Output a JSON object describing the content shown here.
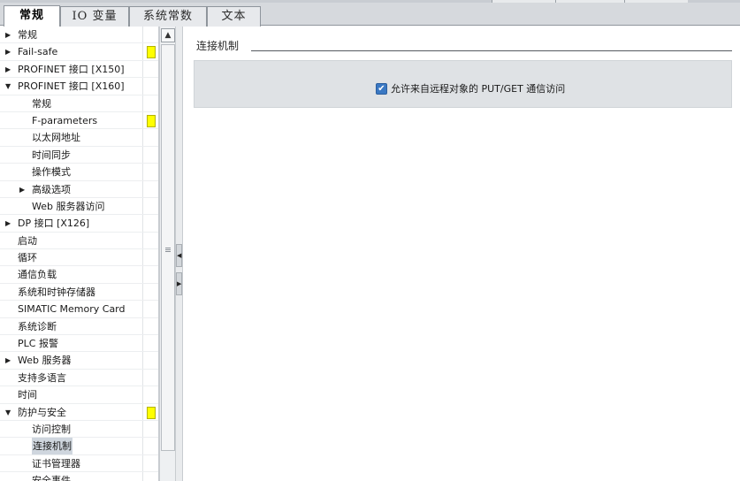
{
  "tabs": [
    {
      "label": "常规",
      "active": true
    },
    {
      "label": "IO 变量",
      "active": false
    },
    {
      "label": "系统常数",
      "active": false
    },
    {
      "label": "文本",
      "active": false
    }
  ],
  "tree": {
    "items": [
      {
        "label": "常规",
        "level": 0,
        "arrow": "right",
        "marker": false,
        "selected": false
      },
      {
        "label": "Fail-safe",
        "level": 0,
        "arrow": "right",
        "marker": true,
        "selected": false
      },
      {
        "label": "PROFINET 接口 [X150]",
        "level": 0,
        "arrow": "right",
        "marker": false,
        "selected": false
      },
      {
        "label": "PROFINET 接口 [X160]",
        "level": 0,
        "arrow": "down",
        "marker": false,
        "selected": false
      },
      {
        "label": "常规",
        "level": 2,
        "arrow": "",
        "marker": false,
        "selected": false
      },
      {
        "label": "F-parameters",
        "level": 2,
        "arrow": "",
        "marker": true,
        "selected": false
      },
      {
        "label": "以太网地址",
        "level": 2,
        "arrow": "",
        "marker": false,
        "selected": false
      },
      {
        "label": "时间同步",
        "level": 2,
        "arrow": "",
        "marker": false,
        "selected": false
      },
      {
        "label": "操作模式",
        "level": 2,
        "arrow": "",
        "marker": false,
        "selected": false
      },
      {
        "label": "高级选项",
        "level": 1,
        "arrow": "right",
        "marker": false,
        "selected": false
      },
      {
        "label": "Web 服务器访问",
        "level": 2,
        "arrow": "",
        "marker": false,
        "selected": false
      },
      {
        "label": "DP 接口 [X126]",
        "level": 0,
        "arrow": "right",
        "marker": false,
        "selected": false
      },
      {
        "label": "启动",
        "level": -1,
        "arrow": "",
        "marker": false,
        "selected": false
      },
      {
        "label": "循环",
        "level": -1,
        "arrow": "",
        "marker": false,
        "selected": false
      },
      {
        "label": "通信负载",
        "level": -1,
        "arrow": "",
        "marker": false,
        "selected": false
      },
      {
        "label": "系统和时钟存储器",
        "level": -1,
        "arrow": "",
        "marker": false,
        "selected": false
      },
      {
        "label": "SIMATIC Memory Card",
        "level": -1,
        "arrow": "",
        "marker": false,
        "selected": false
      },
      {
        "label": "系统诊断",
        "level": -1,
        "arrow": "",
        "marker": false,
        "selected": false
      },
      {
        "label": "PLC 报警",
        "level": -1,
        "arrow": "",
        "marker": false,
        "selected": false
      },
      {
        "label": "Web 服务器",
        "level": 0,
        "arrow": "right",
        "marker": false,
        "selected": false
      },
      {
        "label": "支持多语言",
        "level": -1,
        "arrow": "",
        "marker": false,
        "selected": false
      },
      {
        "label": "时间",
        "level": -1,
        "arrow": "",
        "marker": false,
        "selected": false
      },
      {
        "label": "防护与安全",
        "level": 0,
        "arrow": "down",
        "marker": true,
        "selected": false
      },
      {
        "label": "访问控制",
        "level": 2,
        "arrow": "",
        "marker": false,
        "selected": false
      },
      {
        "label": "连接机制",
        "level": 2,
        "arrow": "",
        "marker": false,
        "selected": true
      },
      {
        "label": "证书管理器",
        "level": 2,
        "arrow": "",
        "marker": false,
        "selected": false
      },
      {
        "label": "安全事件",
        "level": 2,
        "arrow": "",
        "marker": false,
        "selected": false
      }
    ]
  },
  "section": {
    "title": "连接机制",
    "checkbox_label": "允许来自远程对象的 PUT/GET 通信访问",
    "checkbox_checked": true
  },
  "colors": {
    "marker": "#ffff00",
    "checkbox": "#3a78c3",
    "panel": "#dfe2e5",
    "tabbar": "#d6d9dd"
  }
}
